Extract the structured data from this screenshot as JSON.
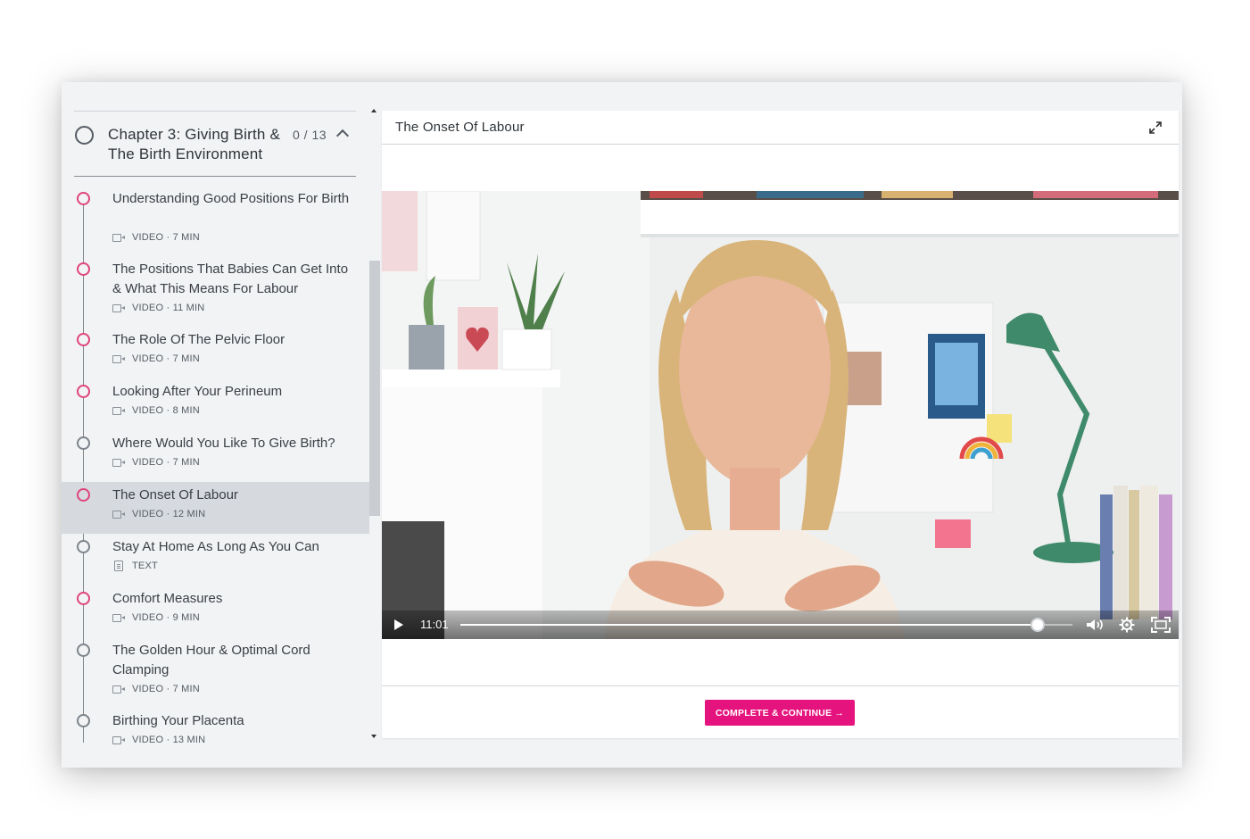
{
  "chapter": {
    "title": "Chapter 3: Giving Birth & The Birth Environment",
    "progress": "0 / 13"
  },
  "lessons": [
    {
      "title": "Understanding Good Positions For Birth",
      "type": "video",
      "meta": "VIDEO · 7 MIN",
      "status": "pink"
    },
    {
      "title": "The Positions That Babies Can Get Into & What This Means For Labour",
      "type": "video",
      "meta": "VIDEO · 11 MIN",
      "status": "pink"
    },
    {
      "title": "The Role Of The Pelvic Floor",
      "type": "video",
      "meta": "VIDEO · 7 MIN",
      "status": "pink"
    },
    {
      "title": "Looking After Your Perineum",
      "type": "video",
      "meta": "VIDEO · 8 MIN",
      "status": "pink"
    },
    {
      "title": "Where Would You Like To Give Birth?",
      "type": "video",
      "meta": "VIDEO · 7 MIN",
      "status": "grey"
    },
    {
      "title": "The Onset Of Labour",
      "type": "video",
      "meta": "VIDEO · 12 MIN",
      "status": "pink",
      "active": true
    },
    {
      "title": "Stay At Home As Long As You Can",
      "type": "text",
      "meta": "TEXT",
      "status": "grey"
    },
    {
      "title": "Comfort Measures",
      "type": "video",
      "meta": "VIDEO · 9 MIN",
      "status": "pink"
    },
    {
      "title": "The Golden Hour & Optimal Cord Clamping",
      "type": "video",
      "meta": "VIDEO · 7 MIN",
      "status": "grey"
    },
    {
      "title": "Birthing Your Placenta",
      "type": "video",
      "meta": "VIDEO · 13 MIN",
      "status": "grey"
    }
  ],
  "main": {
    "title": "The Onset Of Labour",
    "player": {
      "time": "11:01",
      "progress": 0.943
    },
    "complete_button": "COMPLETE & CONTINUE →"
  },
  "colors": {
    "accent": "#e5137d",
    "dot_pink": "#e0457b",
    "dot_grey": "#7d848b"
  },
  "icons": [
    "chevron-up-icon",
    "expand-icon",
    "play-icon",
    "volume-icon",
    "gear-icon",
    "fullscreen-icon",
    "video-camera-icon",
    "document-icon"
  ]
}
